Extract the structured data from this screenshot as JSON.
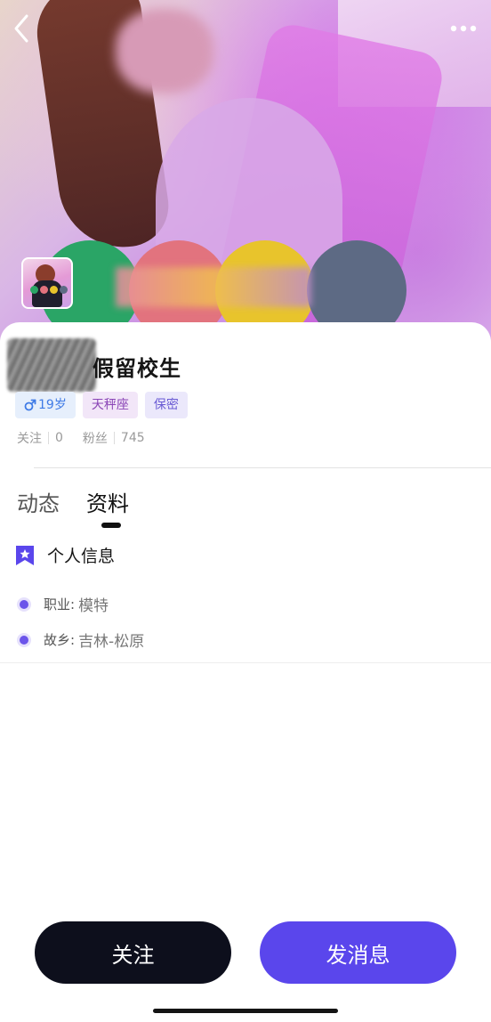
{
  "header": {
    "back_icon": "chevron-left-icon",
    "more_icon": "more-dots-icon"
  },
  "profile": {
    "name": "假留校生",
    "tags": {
      "age": "19岁",
      "gender_icon": "male-icon",
      "zodiac": "天秤座",
      "privacy": "保密"
    },
    "stats": {
      "following_label": "关注",
      "following_count": "0",
      "fans_label": "粉丝",
      "fans_count": "745"
    }
  },
  "tabs": [
    {
      "label": "动态",
      "active": false
    },
    {
      "label": "资料",
      "active": true
    }
  ],
  "info_section": {
    "title": "个人信息",
    "icon": "bookmark-star-icon",
    "rows": [
      {
        "label": "职业:",
        "value": "模特"
      },
      {
        "label": "故乡:",
        "value": "吉林-松原"
      }
    ]
  },
  "actions": {
    "follow_label": "关注",
    "message_label": "发消息"
  },
  "colors": {
    "accent": "#5a46ec",
    "follow_button": "#0d0f1c",
    "age_tag": "#3f7be6",
    "zodiac_tag": "#8a45b6",
    "privacy_tag": "#6a5bd4"
  }
}
